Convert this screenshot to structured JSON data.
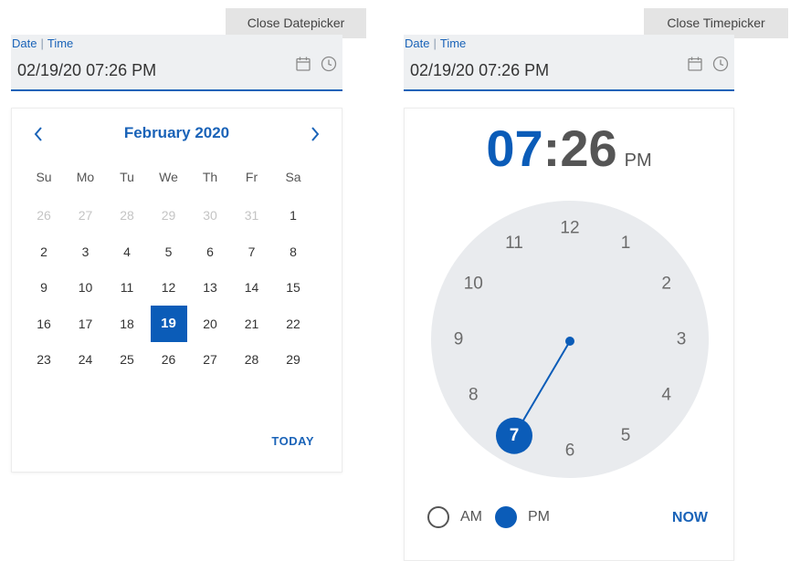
{
  "datepicker": {
    "tooltip": "Close Datepicker",
    "field": {
      "label_date": "Date",
      "label_sep": "|",
      "label_time": "Time",
      "value": "02/19/20 07:26 PM"
    },
    "calendar": {
      "month_title": "February 2020",
      "prev_icon": "chevron-left-icon",
      "next_icon": "chevron-right-icon",
      "weekdays": [
        "Su",
        "Mo",
        "Tu",
        "We",
        "Th",
        "Fr",
        "Sa"
      ],
      "weeks": [
        [
          "26",
          "27",
          "28",
          "29",
          "30",
          "31",
          "1"
        ],
        [
          "2",
          "3",
          "4",
          "5",
          "6",
          "7",
          "8"
        ],
        [
          "9",
          "10",
          "11",
          "12",
          "13",
          "14",
          "15"
        ],
        [
          "16",
          "17",
          "18",
          "19",
          "20",
          "21",
          "22"
        ],
        [
          "23",
          "24",
          "25",
          "26",
          "27",
          "28",
          "29"
        ]
      ],
      "muted_first_row_count": 6,
      "selected_day": "19",
      "today_label": "TODAY"
    }
  },
  "timepicker": {
    "tooltip": "Close Timepicker",
    "field": {
      "label_date": "Date",
      "label_sep": "|",
      "label_time": "Time",
      "value": "02/19/20 07:26 PM"
    },
    "display": {
      "hours": "07",
      "colon": ":",
      "minutes": "26",
      "period": "PM"
    },
    "clock": {
      "numbers": [
        "12",
        "1",
        "2",
        "3",
        "4",
        "5",
        "6",
        "7",
        "8",
        "9",
        "10",
        "11"
      ],
      "selected_hour": "7"
    },
    "am_label": "AM",
    "pm_label": "PM",
    "selected_period": "PM",
    "now_label": "NOW"
  },
  "colors": {
    "accent": "#0b5cb8",
    "field_bg": "#eef0f2",
    "clock_face": "#e9ebee"
  }
}
